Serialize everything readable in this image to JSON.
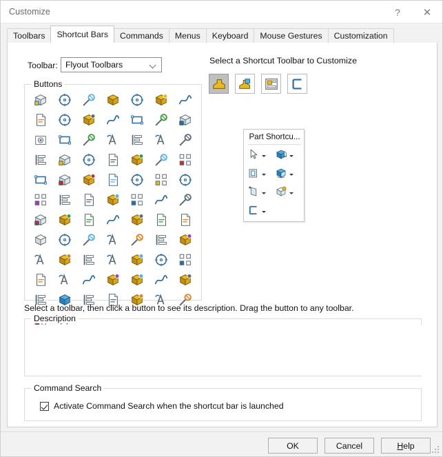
{
  "window": {
    "title": "Customize",
    "help_button": "?",
    "close_button": "✕"
  },
  "tabs": [
    {
      "label": "Toolbars",
      "active": false
    },
    {
      "label": "Shortcut Bars",
      "active": true
    },
    {
      "label": "Commands",
      "active": false
    },
    {
      "label": "Menus",
      "active": false
    },
    {
      "label": "Keyboard",
      "active": false
    },
    {
      "label": "Mouse Gestures",
      "active": false
    },
    {
      "label": "Customization",
      "active": false
    }
  ],
  "toolbar_select": {
    "label": "Toolbar:",
    "value": "Flyout Toolbars",
    "options": [
      "Flyout Toolbars"
    ]
  },
  "buttons_group": {
    "title": "Buttons",
    "columns": 7,
    "rows": 10,
    "icons": [
      "assembly-features-icon",
      "align-list-icon",
      "annotation-text-icon",
      "part-block-icon",
      "area-note-icon",
      "spline-curve-icon",
      "mate-reference-icon",
      "layout-sketch-icon",
      "smart-components-icon",
      "configurations-icon",
      "font-style-icon",
      "draft-analysis-icon",
      "color-bar-icon",
      "document-play-icon",
      "render-box-icon",
      "circular-pattern-icon",
      "mirror-part-icon",
      "appearance-sphere-icon",
      "photoview-icon",
      "filter-icon",
      "window-split-icon",
      "exploded-view-icon",
      "corner-sketch-icon",
      "sketch-pencil-icon",
      "3d-cube-red-icon",
      "curve-wave-icon",
      "copy-document-icon",
      "save-as-icon",
      "boundary-surface-icon",
      "balloon-callout-icon",
      "table-grid-icon",
      "toolbox-icon",
      "zoom-search-icon",
      "globe-web-icon",
      "pack-and-go-icon",
      "new-document-icon",
      "open-folder-icon",
      "save-disk-icon",
      "print-icon",
      "options-gear-icon",
      "corner-rectangle-icon",
      "line-sketch-icon",
      "rectangle-sketch-icon",
      "slot-sketch-icon",
      "circle-sketch-icon",
      "arc-sketch-icon",
      "ellipse-sketch-icon",
      "spline-icon",
      "fillet-sketch-icon",
      "cube-solid-icon",
      "trim-entities-icon",
      "offset-entities-icon",
      "linear-pattern-icon",
      "perpendicular-relation-icon",
      "move-entities-icon",
      "extrude-boss-icon",
      "extrude-cut-icon",
      "revolve-boss-icon",
      "pattern-feature-icon",
      "draft-feature-icon",
      "insert-component-icon",
      "component-pattern-icon",
      "edit-part-icon",
      "mirror-component-icon",
      "replace-component-icon",
      "text-rows-icon",
      "display-monitor-icon",
      "measure-tool-icon",
      "fasteners-icon",
      "smart-fasteners-icon",
      "belt-chain-icon",
      "isometric-cube-icon",
      "photo-render-icon",
      "mate-distance-icon",
      "edit-sketch-pencil-icon",
      "smart-dimension-icon",
      "ruler-measure-icon",
      "rebuild-colors-icon",
      "assembly-stats-icon"
    ]
  },
  "hint_text": "Select a toolbar, then click a button to see its description. Drag the button to any toolbar.",
  "description_group": {
    "title": "Description",
    "content": ""
  },
  "command_search_group": {
    "title": "Command Search",
    "checkbox_label": "Activate Command Search when the shortcut bar is launched",
    "checked": true
  },
  "right_panel": {
    "heading": "Select a Shortcut Toolbar to Customize",
    "toolbar_buttons": [
      {
        "name": "part-shortcut-icon",
        "selected": true
      },
      {
        "name": "assembly-shortcut-icon",
        "selected": false
      },
      {
        "name": "drawing-shortcut-icon",
        "selected": false
      },
      {
        "name": "sketch-shortcut-icon",
        "selected": false
      }
    ]
  },
  "flyout_preview": {
    "title": "Part Shortcu...",
    "items": [
      {
        "name": "select-arrow-icon",
        "has_dropdown": true
      },
      {
        "name": "extrude-boss-icon",
        "has_dropdown": true
      },
      {
        "name": "extrude-cut-icon",
        "has_dropdown": true
      },
      {
        "name": "revolve-boss-icon",
        "has_dropdown": true
      },
      {
        "name": "reference-geometry-icon",
        "has_dropdown": true
      },
      {
        "name": "fillet-feature-icon",
        "has_dropdown": true
      },
      {
        "name": "corner-sketch-icon",
        "has_dropdown": true
      }
    ]
  },
  "footer": {
    "ok": "OK",
    "cancel": "Cancel",
    "help_prefix": "H",
    "help_rest": "elp"
  },
  "colors": {
    "accent_blue": "#1f6fb5",
    "icon_gold": "#e8b923",
    "panel_bg": "#ffffff",
    "dialog_bg": "#f2f2f2"
  }
}
